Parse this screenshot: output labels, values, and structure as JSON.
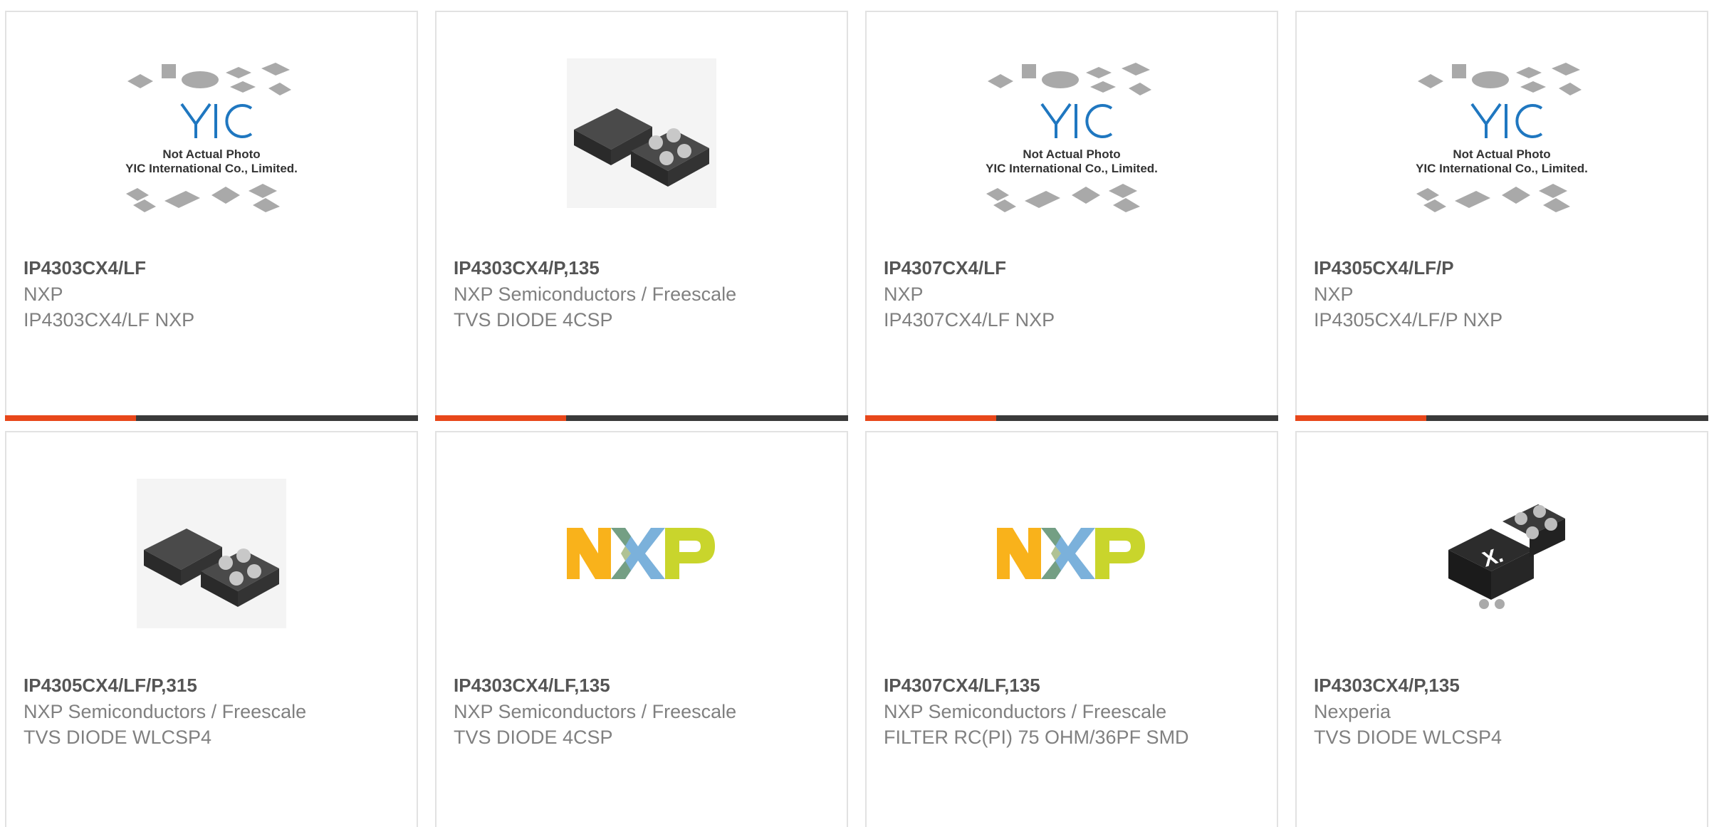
{
  "colors": {
    "accent": "#e8471a",
    "bar": "#3a3a3a",
    "border": "#e2e2e2",
    "title_text": "#555555",
    "body_text": "#808080"
  },
  "placeholder": {
    "brand": "YIC",
    "line1": "Not Actual Photo",
    "line2": "YIC International Co., Limited."
  },
  "products": [
    {
      "part": "IP4303CX4/LF",
      "maker": "NXP",
      "desc": "IP4303CX4/LF NXP",
      "image": "yic-placeholder"
    },
    {
      "part": "IP4303CX4/P,135",
      "maker": "NXP Semiconductors / Freescale",
      "desc": "TVS DIODE 4CSP",
      "image": "chip-4ball"
    },
    {
      "part": "IP4307CX4/LF",
      "maker": "NXP",
      "desc": "IP4307CX4/LF NXP",
      "image": "yic-placeholder"
    },
    {
      "part": "IP4305CX4/LF/P",
      "maker": "NXP",
      "desc": "IP4305CX4/LF/P NXP",
      "image": "yic-placeholder"
    },
    {
      "part": "IP4305CX4/LF/P,315",
      "maker": "NXP Semiconductors / Freescale",
      "desc": "TVS DIODE WLCSP4",
      "image": "chip-4ball"
    },
    {
      "part": "IP4303CX4/LF,135",
      "maker": "NXP Semiconductors / Freescale",
      "desc": "TVS DIODE 4CSP",
      "image": "nxp-logo"
    },
    {
      "part": "IP4307CX4/LF,135",
      "maker": "NXP Semiconductors / Freescale",
      "desc": "FILTER RC(PI) 75 OHM/36PF SMD",
      "image": "nxp-logo"
    },
    {
      "part": "IP4303CX4/P,135",
      "maker": "Nexperia",
      "desc": "TVS DIODE WLCSP4",
      "image": "nexperia-chip"
    }
  ]
}
